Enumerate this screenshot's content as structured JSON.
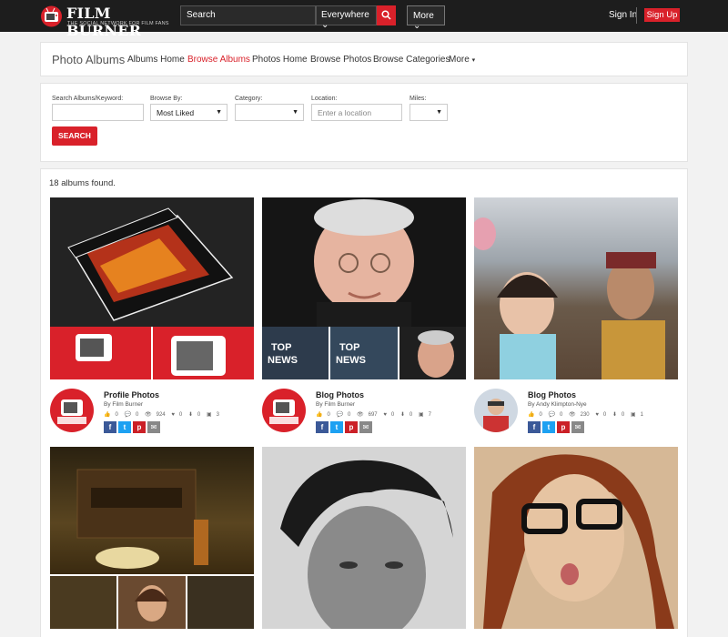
{
  "header": {
    "brand": "FILM BURNER",
    "tagline": "THE SOCIAL NETWORK FOR FILM FANS",
    "search_placeholder": "Search",
    "search_scope": "Everywhere",
    "more_label": "More",
    "signin_label": "Sign In",
    "signup_label": "Sign Up"
  },
  "nav": {
    "title": "Photo Albums",
    "tabs": [
      {
        "label": "Albums Home"
      },
      {
        "label": "Browse Albums"
      },
      {
        "label": "Photos Home"
      },
      {
        "label": "Browse Photos"
      },
      {
        "label": "Browse Categories"
      },
      {
        "label": "More"
      }
    ]
  },
  "filters": {
    "keyword_label": "Search Albums/Keyword:",
    "keyword_value": "",
    "browse_label": "Browse By:",
    "browse_value": "Most Liked",
    "category_label": "Category:",
    "category_value": "",
    "location_label": "Location:",
    "location_placeholder": "Enter a location",
    "miles_label": "Miles:",
    "miles_value": "",
    "search_button": "SEARCH"
  },
  "results": {
    "count_text": "18 albums found.",
    "albums": [
      {
        "title": "Profile Photos",
        "by": "By Film Burner",
        "likes": "0",
        "comments": "0",
        "views": "924",
        "favs": "0",
        "downloads": "0",
        "photos": "3"
      },
      {
        "title": "Blog Photos",
        "by": "By Film Burner",
        "likes": "0",
        "comments": "0",
        "views": "697",
        "favs": "0",
        "downloads": "0",
        "photos": "7"
      },
      {
        "title": "Blog Photos",
        "by": "By Andy Klimpton-Nye",
        "likes": "0",
        "comments": "0",
        "views": "230",
        "favs": "0",
        "downloads": "0",
        "photos": "1"
      }
    ]
  },
  "colors": {
    "accent": "#d9212a",
    "header_bg": "#1d1d1d",
    "facebook": "#3b5998",
    "twitter": "#1da1f2",
    "pinterest": "#cb2027"
  }
}
